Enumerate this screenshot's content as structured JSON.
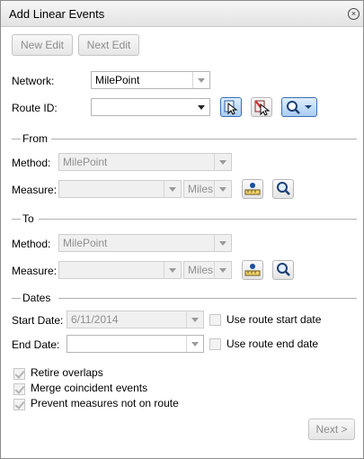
{
  "window": {
    "title": "Add Linear Events"
  },
  "toolbar": {
    "new_edit": "New Edit",
    "next_edit": "Next Edit"
  },
  "network": {
    "label": "Network:",
    "value": "MilePoint"
  },
  "route": {
    "label": "Route ID:",
    "value": ""
  },
  "from": {
    "heading": "From",
    "method_label": "Method:",
    "method_value": "MilePoint",
    "measure_label": "Measure:",
    "measure_value": "",
    "units_value": "Miles"
  },
  "to": {
    "heading": "To",
    "method_label": "Method:",
    "method_value": "MilePoint",
    "measure_label": "Measure:",
    "measure_value": "",
    "units_value": "Miles"
  },
  "dates": {
    "heading": "Dates",
    "start_label": "Start Date:",
    "start_value": "6/11/2014",
    "use_start_label": "Use route start date",
    "end_label": "End Date:",
    "end_value": "",
    "use_end_label": "Use route end date"
  },
  "options": {
    "retire_overlaps": "Retire overlaps",
    "merge_coincident": "Merge coincident events",
    "prevent_measures": "Prevent measures not on route"
  },
  "footer": {
    "next": "Next >"
  }
}
